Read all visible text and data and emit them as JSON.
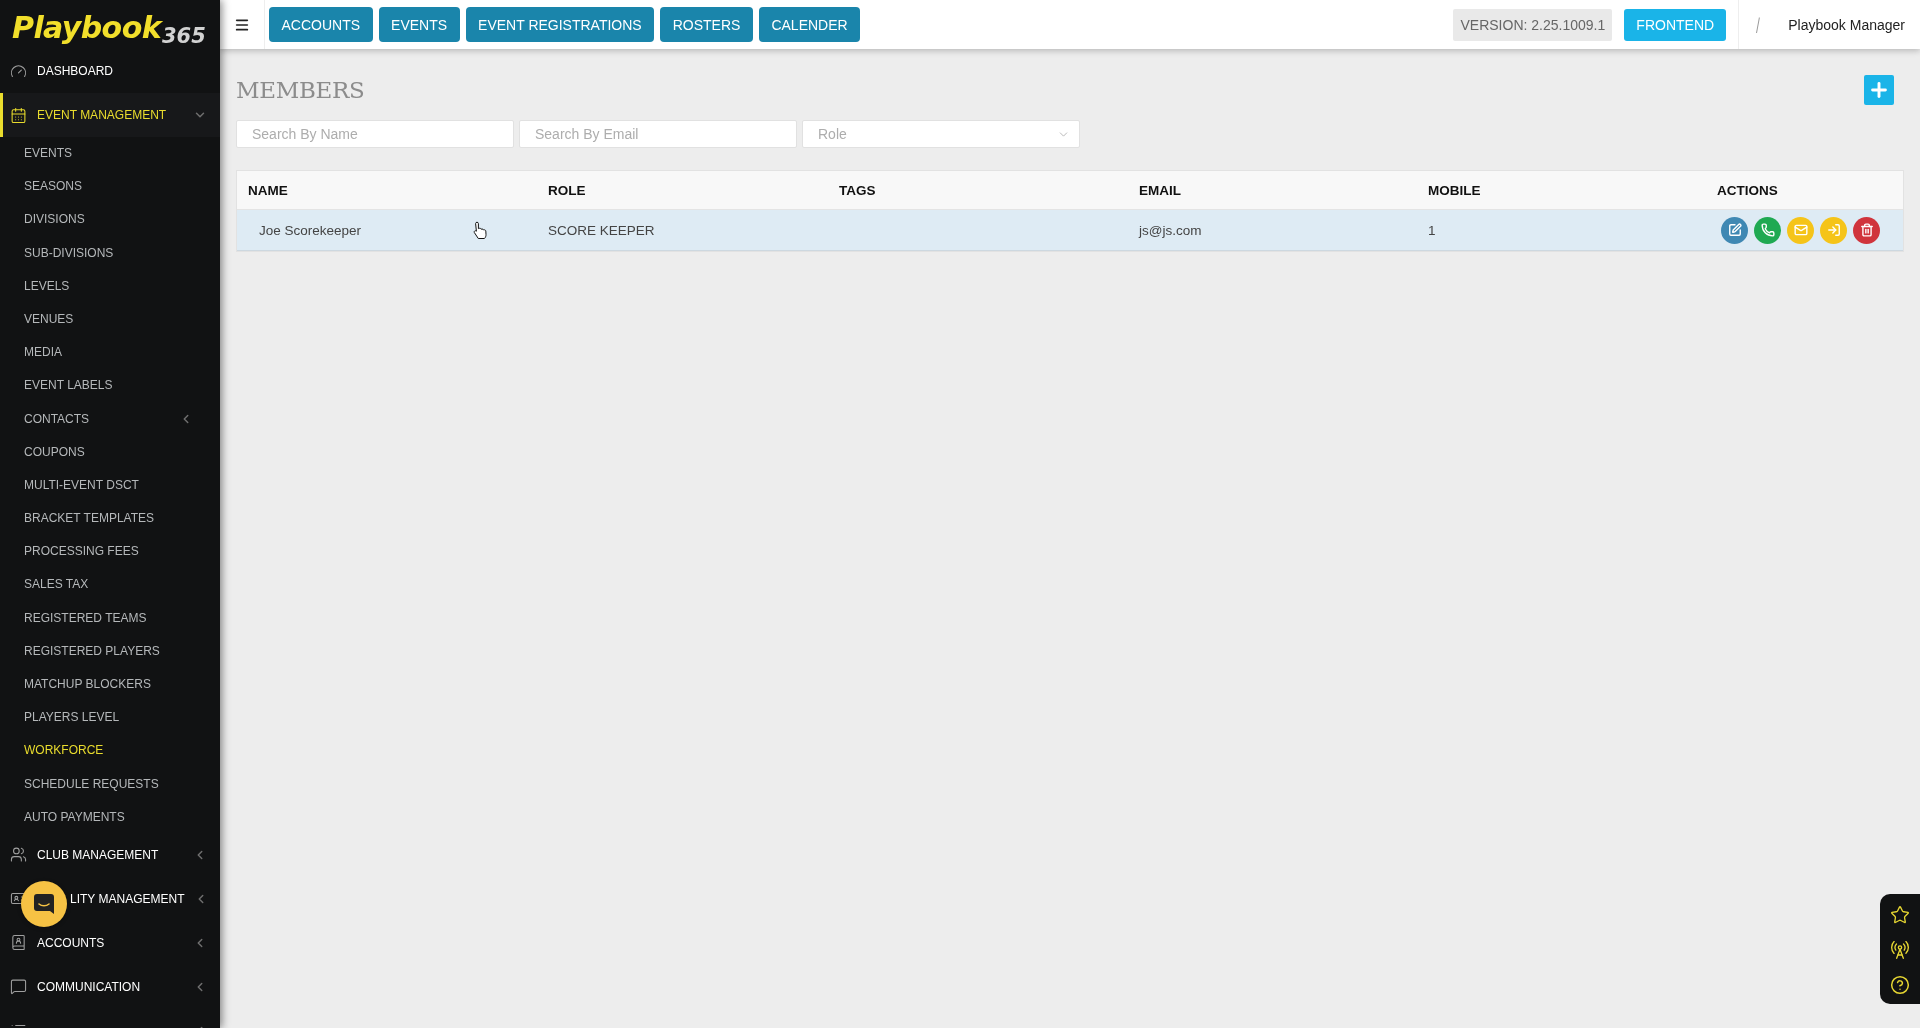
{
  "logo": {
    "word": "Playbook",
    "number": "365"
  },
  "sidebar": {
    "items": [
      {
        "label": "DASHBOARD",
        "selected": false
      },
      {
        "label": "EVENT MANAGEMENT",
        "selected": true,
        "expanded": true,
        "children": [
          {
            "label": "EVENTS",
            "selected": false
          },
          {
            "label": "SEASONS",
            "selected": false
          },
          {
            "label": "DIVISIONS",
            "selected": false
          },
          {
            "label": "SUB-DIVISIONS",
            "selected": false
          },
          {
            "label": "LEVELS",
            "selected": false
          },
          {
            "label": "VENUES",
            "selected": false
          },
          {
            "label": "MEDIA",
            "selected": false
          },
          {
            "label": "EVENT LABELS",
            "selected": false
          },
          {
            "label": "CONTACTS",
            "selected": false,
            "expanded": false
          },
          {
            "label": "COUPONS",
            "selected": false
          },
          {
            "label": "MULTI-EVENT DSCT",
            "selected": false
          },
          {
            "label": "BRACKET TEMPLATES",
            "selected": false
          },
          {
            "label": "PROCESSING FEES",
            "selected": false
          },
          {
            "label": "SALES TAX",
            "selected": false
          },
          {
            "label": "REGISTERED TEAMS",
            "selected": false
          },
          {
            "label": "REGISTERED PLAYERS",
            "selected": false
          },
          {
            "label": "MATCHUP BLOCKERS",
            "selected": false
          },
          {
            "label": "PLAYERS LEVEL",
            "selected": false
          },
          {
            "label": "WORKFORCE",
            "selected": true
          },
          {
            "label": "SCHEDULE REQUESTS",
            "selected": false
          },
          {
            "label": "AUTO PAYMENTS",
            "selected": false
          }
        ]
      },
      {
        "label": "CLUB MANAGEMENT",
        "selected": false,
        "expanded": false
      },
      {
        "label": "LITY MANAGEMENT",
        "selected": false,
        "expanded": false,
        "partly_hidden": true
      },
      {
        "label": "ACCOUNTS",
        "selected": false,
        "expanded": false
      },
      {
        "label": "COMMUNICATION",
        "selected": false,
        "expanded": false
      },
      {
        "selected": false,
        "expanded": false
      }
    ]
  },
  "topbar": {
    "nav_buttons": [
      "ACCOUNTS",
      "EVENTS",
      "EVENT REGISTRATIONS",
      "ROSTERS",
      "CALENDER"
    ],
    "version": "VERSION: 2.25.1009.1",
    "frontend_button": "FRONTEND",
    "user_name": "Playbook Manager"
  },
  "page": {
    "title": "MEMBERS",
    "filters": [
      {
        "kind": "text",
        "placeholder": "Search By Name"
      },
      {
        "kind": "text",
        "placeholder": "Search By Email"
      },
      {
        "kind": "select",
        "placeholder": "Role"
      }
    ]
  },
  "table": {
    "columns": [
      "NAME",
      "ROLE",
      "TAGS",
      "EMAIL",
      "MOBILE",
      "ACTIONS"
    ],
    "rows": [
      {
        "name": "Joe Scorekeeper",
        "role": "SCORE KEEPER",
        "email": "js@js.com",
        "mobile": "1",
        "hovered": true
      }
    ]
  }
}
